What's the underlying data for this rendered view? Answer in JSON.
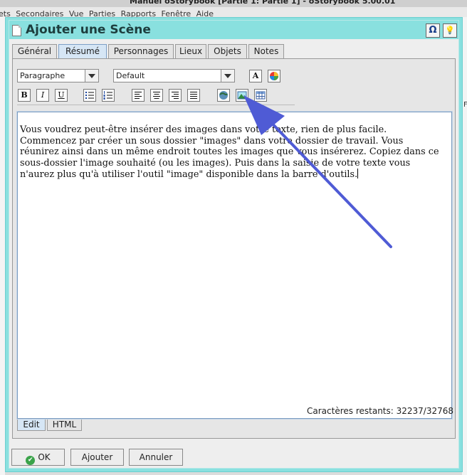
{
  "background": {
    "window_title": "Manuel oStorybook [Partie 1: Partie 1] - oStorybook 5.00.01",
    "menu_fragment": "ets Secondaires  Vue  Parties  Rapports  Fenêtre  Aide",
    "right_edge_text": "F"
  },
  "dialog": {
    "title": "Ajouter une Scène",
    "buttons": {
      "special_chars": "Ω",
      "hint": "💡"
    },
    "tabs": [
      "Général",
      "Résumé",
      "Personnages",
      "Lieux",
      "Objets",
      "Notes"
    ],
    "active_tab": "Résumé"
  },
  "toolbar": {
    "paragraph_style": "Paragraphe",
    "font": "Default",
    "bold": "B",
    "italic": "I",
    "underline": "U"
  },
  "editor": {
    "content": "Vous voudrez peut-être insérer des images dans votre texte, rien de plus facile. Commencez par créer un sous dossier \"images\" dans votre dossier de travail. Vous réunirez ainsi dans un même endroit toutes les images que vous insérerez. Copiez dans ce sous-dossier l'image souhaité (ou les images). Puis dans la saisie de votre texte vous n'aurez plus qu'à utiliser l'outil \"image\" disponible dans la barre d'outils.",
    "lines": [
      "Vous voudrez peut-être insérer des images dans votre texte, rien de plus facile.",
      "Commencez par créer un sous dossier \"images\" dans votre dossier de travail. Vous",
      "réunirez ainsi dans un même endroit toutes les images que vous insérerez. Copiez dans ce",
      "sous-dossier l'image souhaité (ou les images). Puis dans la saisie de votre texte vous",
      "n'aurez plus qu'à utiliser l'outil \"image\" disponible dans la barre d'outils."
    ],
    "bottom_tabs": [
      "Edit",
      "HTML"
    ],
    "active_bottom_tab": "Edit",
    "chars_remaining": "Caractères restants: 32237/32768"
  },
  "footer": {
    "ok": "OK",
    "add": "Ajouter",
    "cancel": "Annuler"
  },
  "colors": {
    "dialog_accent": "#89e0df",
    "annotation_arrow": "#4f5bd5"
  }
}
